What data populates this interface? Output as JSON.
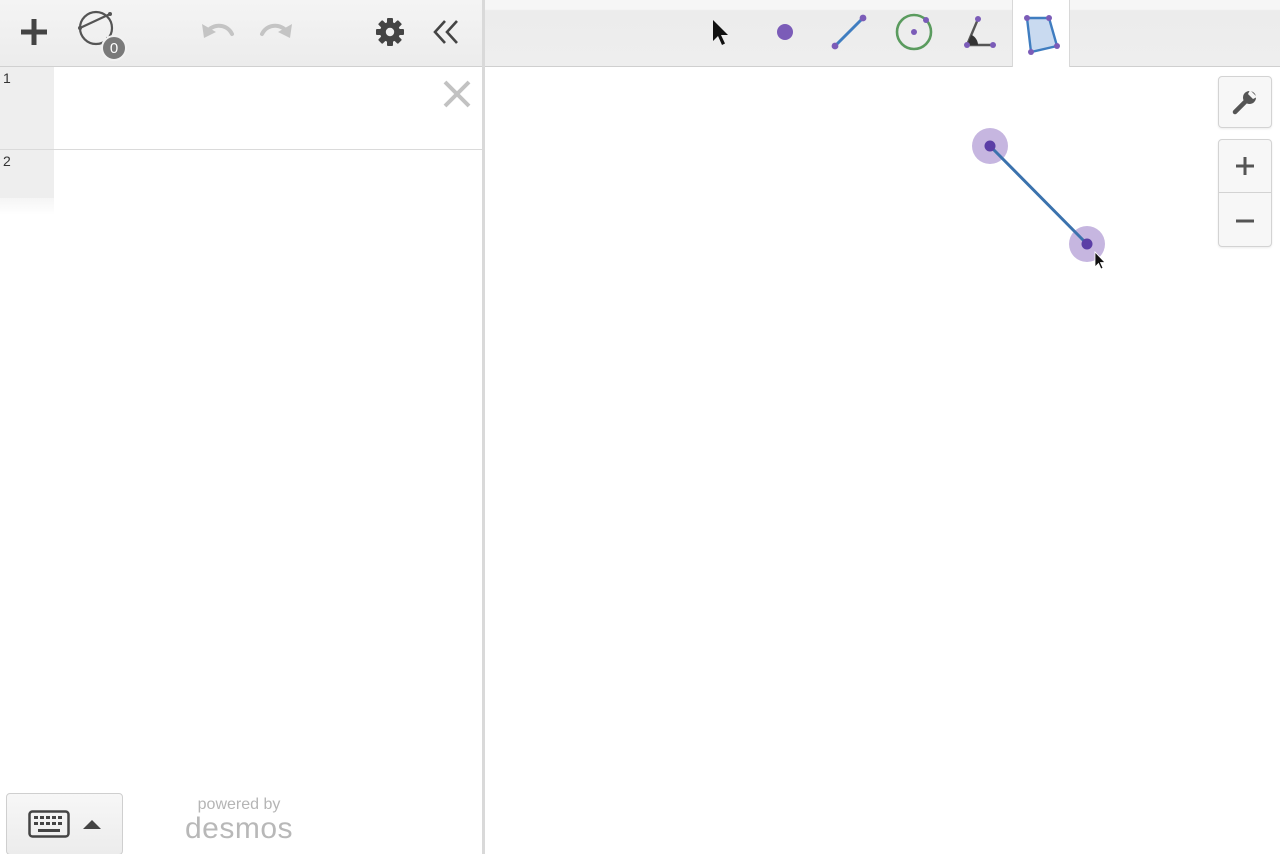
{
  "app": {
    "brand_line1": "powered by",
    "brand_line2": "desmos"
  },
  "toolbar_left": {
    "add_icon": "plus-icon",
    "shapes_icon": "geometry-shapes-icon",
    "shapes_count": "0",
    "undo_icon": "undo-icon",
    "redo_icon": "redo-icon",
    "settings_icon": "gear-icon",
    "collapse_icon": "double-chevron-left-icon"
  },
  "expressions": [
    {
      "index": "1",
      "value": ""
    },
    {
      "index": "2",
      "value": ""
    }
  ],
  "geometry_tools": [
    {
      "name": "select",
      "icon": "arrow-pointer-icon",
      "active": false
    },
    {
      "name": "point",
      "icon": "point-icon",
      "active": false
    },
    {
      "name": "segment",
      "icon": "segment-icon",
      "active": false
    },
    {
      "name": "circle",
      "icon": "circle-icon",
      "active": false
    },
    {
      "name": "angle",
      "icon": "angle-icon",
      "active": false
    },
    {
      "name": "polygon",
      "icon": "polygon-icon",
      "active": true
    }
  ],
  "canvas_controls": {
    "wrench_icon": "wrench-icon",
    "zoom_in_icon": "zoom-in-plus-icon",
    "zoom_out_icon": "zoom-out-minus-icon"
  },
  "keyboard": {
    "icon": "keyboard-icon",
    "toggle_icon": "caret-up-icon"
  },
  "colors": {
    "point": "#6042a6",
    "point_halo": "#c6b6e0",
    "segment": "#3b72ad",
    "circle_tool": "#5a9b5e",
    "toolbar_bg": "#eeeeee",
    "icon_gray": "#555555",
    "icon_disabled": "#c4c4c4"
  }
}
